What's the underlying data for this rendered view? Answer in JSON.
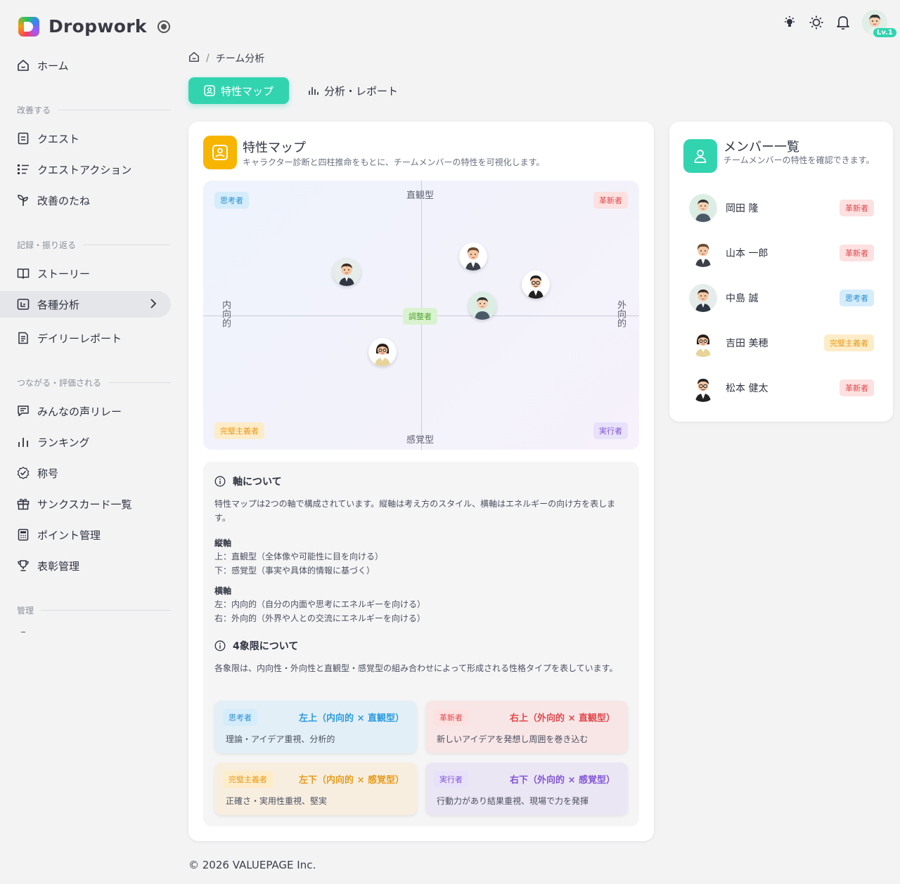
{
  "app": {
    "name": "Dropwork",
    "level": "Lv.1"
  },
  "sidebar": {
    "home": "ホーム",
    "sections": [
      {
        "label": "改善する"
      },
      {
        "label": "記録・振り返る"
      },
      {
        "label": "つながる・評価される"
      },
      {
        "label": "管理"
      }
    ],
    "items": [
      {
        "label": "クエスト"
      },
      {
        "label": "クエストアクション"
      },
      {
        "label": "改善のたね"
      },
      {
        "label": "ストーリー"
      },
      {
        "label": "各種分析"
      },
      {
        "label": "デイリーレポート"
      },
      {
        "label": "みんなの声リレー"
      },
      {
        "label": "ランキング"
      },
      {
        "label": "称号"
      },
      {
        "label": "サンクスカード一覧"
      },
      {
        "label": "ポイント管理"
      },
      {
        "label": "表彰管理"
      }
    ]
  },
  "breadcrumb": {
    "current": "チーム分析"
  },
  "tabs": {
    "active": "特性マップ",
    "other": "分析・レポート"
  },
  "map_card": {
    "title": "特性マップ",
    "subtitle": "キャラクター診断と四柱推命をもとに、チームメンバーの特性を可視化します。",
    "axis_top": "直観型",
    "axis_bottom": "感覚型",
    "axis_left": "内向的",
    "axis_right": "外向的",
    "center": "調整者",
    "quadrants": {
      "tl": "思考者",
      "tr": "革新者",
      "bl": "完璧主義者",
      "br": "実行者"
    }
  },
  "info": {
    "axis_title": "軸について",
    "axis_desc": "特性マップは2つの軸で構成されています。縦軸は考え方のスタイル、横軸はエネルギーの向け方を表します。",
    "v_title": "縦軸",
    "v_up": "上：直観型（全体像や可能性に目を向ける）",
    "v_down": "下：感覚型（事実や具体的情報に基づく）",
    "h_title": "横軸",
    "h_left": "左：内向的（自分の内面や思考にエネルギーを向ける）",
    "h_right": "右：外向的（外界や人との交流にエネルギーを向ける）",
    "quad_title": "4象限について",
    "quad_desc": "各象限は、内向性・外向性と直観型・感覚型の組み合わせによって形成される性格タイプを表しています。",
    "boxes": [
      {
        "badge": "思考者",
        "title": "左上（内向的 × 直観型）",
        "desc": "理論・アイデア重視、分析的"
      },
      {
        "badge": "革新者",
        "title": "右上（外向的 × 直観型）",
        "desc": "新しいアイデアを発想し周囲を巻き込む"
      },
      {
        "badge": "完璧主義者",
        "title": "左下（内向的 × 感覚型）",
        "desc": "正確さ・実用性重視、堅実"
      },
      {
        "badge": "実行者",
        "title": "右下（外向的 × 感覚型）",
        "desc": "行動力があり結果重視、現場で力を発揮"
      }
    ]
  },
  "members": {
    "title": "メンバー一覧",
    "subtitle": "チームメンバーの特性を確認できます。",
    "list": [
      {
        "name": "岡田 隆",
        "type": "革新者"
      },
      {
        "name": "山本 一郎",
        "type": "革新者"
      },
      {
        "name": "中島 誠",
        "type": "思考者"
      },
      {
        "name": "吉田 美穂",
        "type": "完璧主義者"
      },
      {
        "name": "松本 健太",
        "type": "革新者"
      }
    ]
  },
  "footer": {
    "text": "© 2026 VALUEPAGE Inc."
  }
}
